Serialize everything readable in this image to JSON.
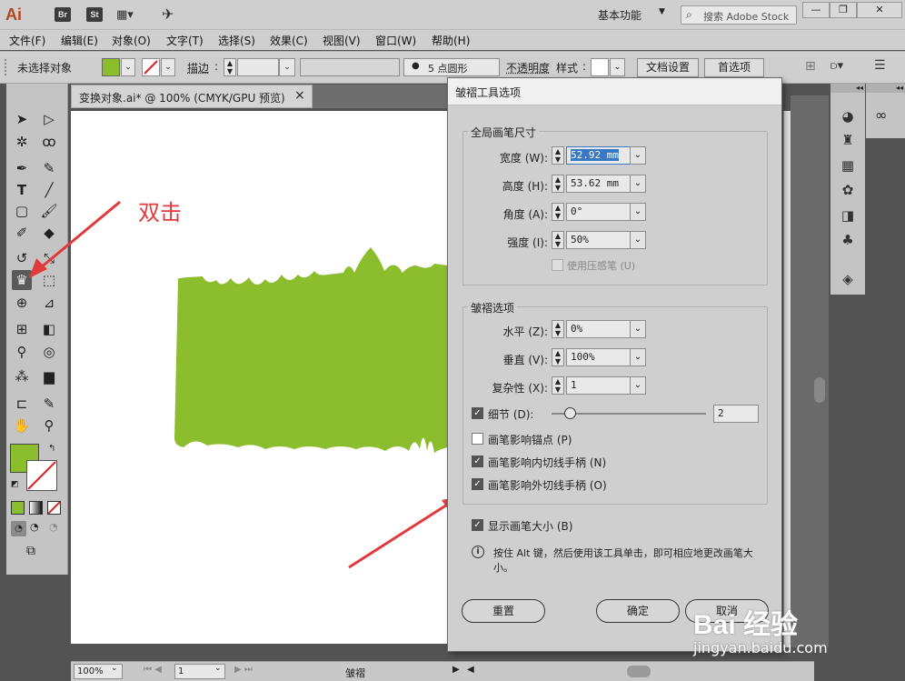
{
  "app": {
    "logo": "Ai",
    "bridge_icon": "Br",
    "stock_icon": "St",
    "workspace": "基本功能",
    "search_placeholder": "搜索 Adobe Stock",
    "window_controls": [
      "—",
      "❐",
      "✕"
    ]
  },
  "menu": [
    "文件(F)",
    "编辑(E)",
    "对象(O)",
    "文字(T)",
    "选择(S)",
    "效果(C)",
    "视图(V)",
    "窗口(W)",
    "帮助(H)"
  ],
  "control_bar": {
    "selection": "未选择对象",
    "fill_color": "#8cbd2d",
    "stroke_label": "描边",
    "brush": "5 点圆形",
    "opacity_label": "不透明度",
    "style_label": "样式",
    "doc_setup": "文档设置",
    "preferences": "首选项"
  },
  "document": {
    "tab_title": "变换对象.ai* @ 100% (CMYK/GPU 预览)",
    "close": "×",
    "zoom": "100%",
    "page": "1",
    "tool_status": "皱褶",
    "artwork_color": "#8cbd2d"
  },
  "dialog": {
    "title": "皱褶工具选项",
    "global_brush": {
      "title": "全局画笔尺寸",
      "width_label": "宽度 (W):",
      "width_value": "52.92 mm",
      "height_label": "高度 (H):",
      "height_value": "53.62 mm",
      "angle_label": "角度 (A):",
      "angle_value": "0°",
      "intensity_label": "强度 (I):",
      "intensity_value": "50%",
      "pressure_label": "使用压感笔 (U)",
      "pressure_checked": false
    },
    "crinkle": {
      "title": "皱褶选项",
      "horizontal_label": "水平 (Z):",
      "horizontal_value": "0%",
      "vertical_label": "垂直 (V):",
      "vertical_value": "100%",
      "complexity_label": "复杂性 (X):",
      "complexity_value": "1",
      "detail_label": "细节 (D):",
      "detail_checked": true,
      "detail_value": "2",
      "detail_slider_fraction": 0.12,
      "anchor_label": "画笔影响锚点 (P)",
      "anchor_checked": false,
      "in_handle_label": "画笔影响内切线手柄 (N)",
      "in_handle_checked": true,
      "out_handle_label": "画笔影响外切线手柄 (O)",
      "out_handle_checked": true
    },
    "show_brush_label": "显示画笔大小 (B)",
    "show_brush_checked": true,
    "info_text": "按住 Alt 键，然后使用该工具单击，即可相应地更改画笔大小。",
    "reset": "重置",
    "ok": "确定",
    "cancel": "取消"
  },
  "annotation": {
    "text": "双击",
    "color": "#e23a3a"
  },
  "watermark": {
    "logo": "Bai 经验",
    "url": "jingyan.baidu.com"
  }
}
